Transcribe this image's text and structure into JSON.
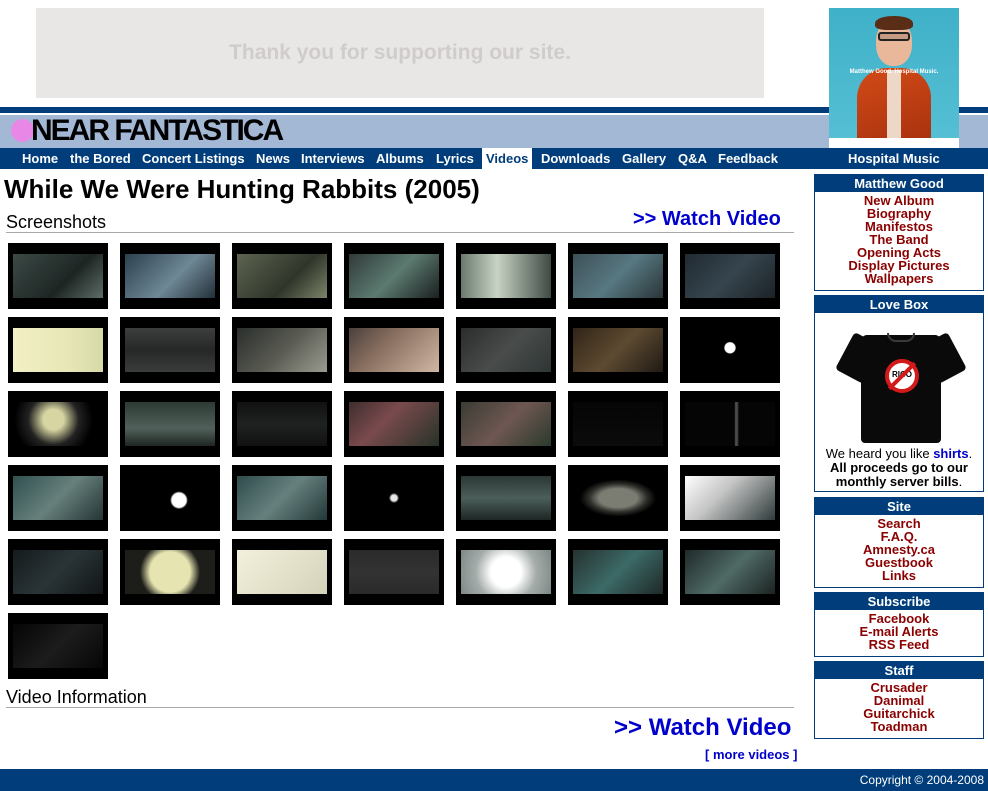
{
  "ad_banner": {
    "text": "Thank you for supporting our site."
  },
  "album_art": {
    "caption": "Matthew Good. Hospital Music."
  },
  "brand": {
    "logo_text": "NEAR FANTASTICA"
  },
  "nav": {
    "items": [
      {
        "label": "Home"
      },
      {
        "label": "the Bored"
      },
      {
        "label": "Concert Listings"
      },
      {
        "label": "News"
      },
      {
        "label": "Interviews"
      },
      {
        "label": "Albums"
      },
      {
        "label": "Lyrics"
      },
      {
        "label": "Videos",
        "active": true
      },
      {
        "label": "Downloads"
      },
      {
        "label": "Gallery"
      },
      {
        "label": "Q&A"
      },
      {
        "label": "Feedback"
      }
    ],
    "right_label": "Hospital Music"
  },
  "main": {
    "title": "While We Were Hunting Rabbits (2005)",
    "screenshots_heading": "Screenshots",
    "watch_video_top": ">> Watch Video",
    "video_info_heading": "Video Information",
    "watch_video_bottom": ">> Watch Video",
    "more_videos": "[ more videos ]",
    "thumbnail_count": 36
  },
  "sidebar": {
    "matthew_good": {
      "heading": "Matthew Good",
      "links": [
        "New Album",
        "Biography",
        "Manifestos",
        "The Band",
        "Opening Acts",
        "Display Pictures",
        "Wallpapers"
      ]
    },
    "love_box": {
      "heading": "Love Box",
      "shirt_text": "RICO",
      "text_before": "We heard you like ",
      "link": "shirts",
      "text_after": ".",
      "note": "All proceeds go to our monthly server bills",
      "note_end": "."
    },
    "site": {
      "heading": "Site",
      "links": [
        "Search",
        "F.A.Q.",
        "Amnesty.ca",
        "Guestbook",
        "Links"
      ]
    },
    "subscribe": {
      "heading": "Subscribe",
      "links": [
        "Facebook",
        "E-mail Alerts",
        "RSS Feed"
      ]
    },
    "staff": {
      "heading": "Staff",
      "links": [
        "Crusader",
        "Danimal",
        "Guitarchick",
        "Toadman"
      ]
    }
  },
  "footer": {
    "copyright": "Copyright © 2004-2008"
  },
  "colors": {
    "nav_bg": "#003d7a",
    "brand_band": "#a3b8d5",
    "sidebar_link": "#8b0000",
    "link_blue": "#0000cc",
    "logo_dot": "#e987e7"
  }
}
